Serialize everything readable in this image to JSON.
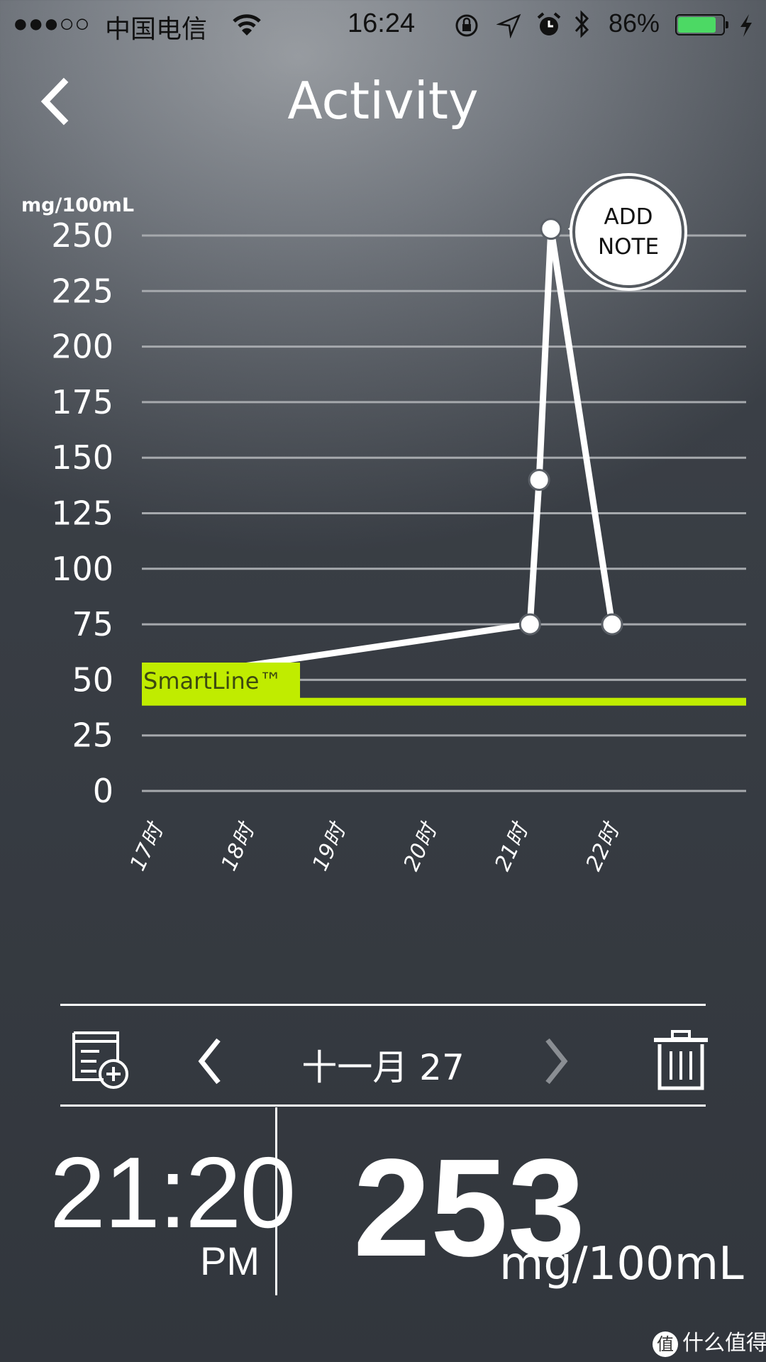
{
  "status_bar": {
    "signal": "●●●○○",
    "carrier": "中国电信",
    "time": "16:24",
    "battery": "86%",
    "battery_level": 0.86,
    "battery_color": "#4cd964",
    "icons": [
      "wifi-icon",
      "rotation-lock-icon",
      "location-icon",
      "alarm-icon",
      "bluetooth-icon",
      "battery-icon",
      "charging-icon"
    ]
  },
  "header": {
    "title": "Activity",
    "back_icon": "chevron-left-icon"
  },
  "chart_data": {
    "type": "line",
    "ylabel": "mg/100mL",
    "ylim": [
      0,
      250
    ],
    "yticks": [
      "0",
      "25",
      "50",
      "75",
      "100",
      "125",
      "150",
      "175",
      "200",
      "225",
      "250"
    ],
    "xlim_hours": [
      17,
      23.5
    ],
    "xticks": [
      {
        "hour": 17,
        "label": "17时"
      },
      {
        "hour": 18,
        "label": "18时"
      },
      {
        "hour": 19,
        "label": "19时"
      },
      {
        "hour": 20,
        "label": "20时"
      },
      {
        "hour": 21,
        "label": "21时"
      },
      {
        "hour": 22,
        "label": "22时"
      }
    ],
    "grid": true,
    "points": [
      {
        "hour": 17.6,
        "value": 54
      },
      {
        "hour": 21.1,
        "value": 75
      },
      {
        "hour": 21.2,
        "value": 140
      },
      {
        "hour": 21.33,
        "value": 253
      },
      {
        "hour": 22.0,
        "value": 75
      }
    ],
    "smartline": {
      "label": "SmartLine™",
      "value": 40,
      "color": "#c0ec00"
    },
    "selected_index": 3,
    "line_color": "#ffffff"
  },
  "add_note": {
    "line1": "ADD",
    "line2": "NOTE"
  },
  "toolbar": {
    "add_note_icon": "note-add-icon",
    "prev_icon": "chevron-left-icon",
    "date": "十一月 27",
    "next_icon": "chevron-right-icon",
    "delete_icon": "trash-icon"
  },
  "reading": {
    "time": "21:20",
    "ampm": "PM",
    "value": "253",
    "unit": "mg/100mL"
  },
  "watermark": {
    "logo": "值",
    "text": "什么值得买"
  }
}
